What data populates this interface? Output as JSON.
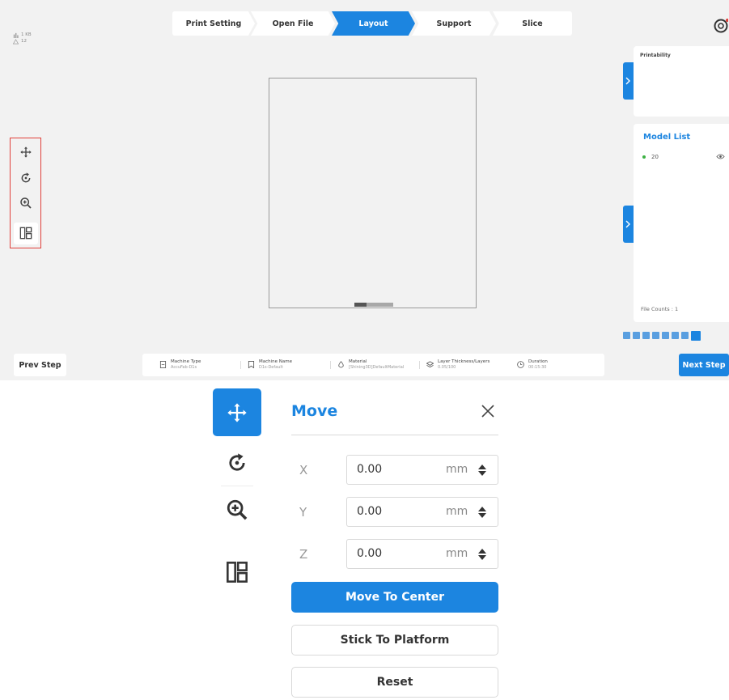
{
  "steps": [
    "Print Setting",
    "Open File",
    "Layout",
    "Support",
    "Slice"
  ],
  "active_step": "Layout",
  "stats": {
    "size": "1 KB",
    "warnings": "12"
  },
  "printability": {
    "title": "Printability"
  },
  "model_list": {
    "title": "Model List",
    "items": [
      "20"
    ],
    "file_counts": "File Counts : 1"
  },
  "nav": {
    "prev": "Prev Step",
    "next": "Next Step"
  },
  "info": {
    "machine_type": {
      "label": "Machine Type",
      "value": "AccuFab-D1s"
    },
    "machine_name": {
      "label": "Machine Name",
      "value": "D1s-Default"
    },
    "material": {
      "label": "Material",
      "value": "[Shining3D]DefaultMaterial"
    },
    "layers": {
      "label": "Layer Thickness/Layers",
      "value": "0.05/100"
    },
    "duration": {
      "label": "Duration",
      "value": "00:15:30"
    }
  },
  "move_panel": {
    "title": "Move",
    "x": {
      "label": "X",
      "value": "0.00",
      "unit": "mm"
    },
    "y": {
      "label": "Y",
      "value": "0.00",
      "unit": "mm"
    },
    "z": {
      "label": "Z",
      "value": "0.00",
      "unit": "mm"
    },
    "center_btn": "Move To Center",
    "stick_btn": "Stick To Platform",
    "reset_btn": "Reset"
  },
  "icons": [
    "move-icon",
    "rotate-icon",
    "zoom-in-icon",
    "layout-icon",
    "settings-icon",
    "eye-icon",
    "close-icon",
    "stepper-icon",
    "chevron-right-icon"
  ],
  "colors": {
    "accent": "#1c85e0",
    "highlight_border": "#e0403a",
    "ok_dot": "#3cb043"
  }
}
